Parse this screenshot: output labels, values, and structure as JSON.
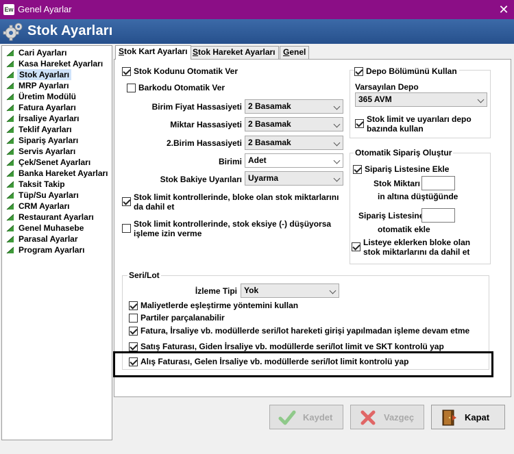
{
  "window": {
    "title": "Genel Ayarlar",
    "app_icon_text": "Ew",
    "close_glyph": "✕"
  },
  "header": {
    "title": "Stok Ayarları"
  },
  "nav": {
    "items": [
      {
        "label": "Cari Ayarları"
      },
      {
        "label": "Kasa Hareket Ayarları"
      },
      {
        "label": "Stok Ayarları",
        "selected": true
      },
      {
        "label": "MRP Ayarları"
      },
      {
        "label": "Üretim Modülü"
      },
      {
        "label": "Fatura Ayarları"
      },
      {
        "label": "İrsaliye Ayarları"
      },
      {
        "label": "Teklif Ayarları"
      },
      {
        "label": "Sipariş Ayarları"
      },
      {
        "label": "Servis Ayarları"
      },
      {
        "label": "Çek/Senet Ayarları"
      },
      {
        "label": "Banka Hareket Ayarları"
      },
      {
        "label": "Taksit Takip"
      },
      {
        "label": "Tüp/Su Ayarları"
      },
      {
        "label": "CRM Ayarları"
      },
      {
        "label": "Restaurant Ayarları"
      },
      {
        "label": "Genel Muhasebe"
      },
      {
        "label": "Parasal Ayarlar"
      },
      {
        "label": "Program Ayarları"
      }
    ]
  },
  "tabs": [
    {
      "first": "S",
      "rest": "tok Kart Ayarları",
      "active": true
    },
    {
      "first": "S",
      "rest": "tok Hareket Ayarları"
    },
    {
      "first": "G",
      "rest": "enel"
    }
  ],
  "stok_kart": {
    "auto_code": {
      "label": "Stok Kodunu Otomatik Ver",
      "checked": true
    },
    "auto_barcode": {
      "label": "Barkodu Otomatik Ver",
      "checked": false
    },
    "fields": [
      {
        "label": "Birim Fiyat Hassasiyeti",
        "value": "2 Basamak"
      },
      {
        "label": "Miktar Hassasiyeti",
        "value": "2 Basamak"
      },
      {
        "label": "2.Birim Hassasiyeti",
        "value": "2 Basamak"
      },
      {
        "label": "Birimi",
        "value": "Adet"
      },
      {
        "label": "Stok Bakiye Uyarıları",
        "value": "Uyarma"
      }
    ],
    "limit_blocked": {
      "line1": "Stok limit kontrollerinde, bloke olan stok miktarlarını",
      "line2": "da dahil et",
      "checked": true
    },
    "limit_negative": {
      "line1": "Stok limit kontrollerinde, stok eksiye (-) düşüyorsa",
      "line2": "işleme izin verme",
      "checked": false
    }
  },
  "depo": {
    "use_depo": {
      "label": "Depo Bölümünü Kullan",
      "checked": true
    },
    "default_label": "Varsayılan Depo",
    "default_value": "365 AVM",
    "depo_based": {
      "line1": "Stok limit ve uyarıları depo",
      "line2": "bazında kullan",
      "checked": true
    }
  },
  "oto_siparis": {
    "title": "Otomatik Sipariş Oluştur",
    "add_list": {
      "label": "Sipariş Listesine Ekle",
      "checked": true
    },
    "stok_miktari_label": "Stok Miktarı",
    "stok_miktari_value": "",
    "altina_label": "in altına düştüğünde",
    "siparis_listesine_label": "Sipariş Listesine",
    "siparis_listesine_value": "",
    "otomatik_ekle_label": "otomatik ekle",
    "include_blocked": {
      "line1": "Listeye eklerken bloke olan",
      "line2": "stok miktarlarını da dahil et",
      "checked": true
    }
  },
  "seri_lot": {
    "title": "Seri/Lot",
    "izleme_label": "İzleme Tipi",
    "izleme_value": "Yok",
    "options": [
      {
        "label": "Maliyetlerde eşleştirme yöntemini kullan",
        "checked": true
      },
      {
        "label": "Partiler parçalanabilir",
        "checked": false
      },
      {
        "label": "Fatura, İrsaliye vb. modüllerde seri/lot hareketi girişi yapılmadan işleme devam etme",
        "checked": true
      },
      {
        "label": "Satış Faturası, Giden İrsaliye vb. modüllerde seri/lot limit ve SKT kontrolü yap",
        "checked": true
      },
      {
        "label": "Alış Faturası, Gelen İrsaliye vb. modüllerde seri/lot limit kontrolü yap",
        "checked": true
      }
    ]
  },
  "buttons": {
    "kaydet": {
      "label": "Kaydet",
      "icon": "check-icon"
    },
    "vazgec": {
      "label": "Vazgeç",
      "icon": "x-icon"
    },
    "kapat": {
      "label": "Kapat",
      "icon": "door-exit-icon"
    }
  }
}
